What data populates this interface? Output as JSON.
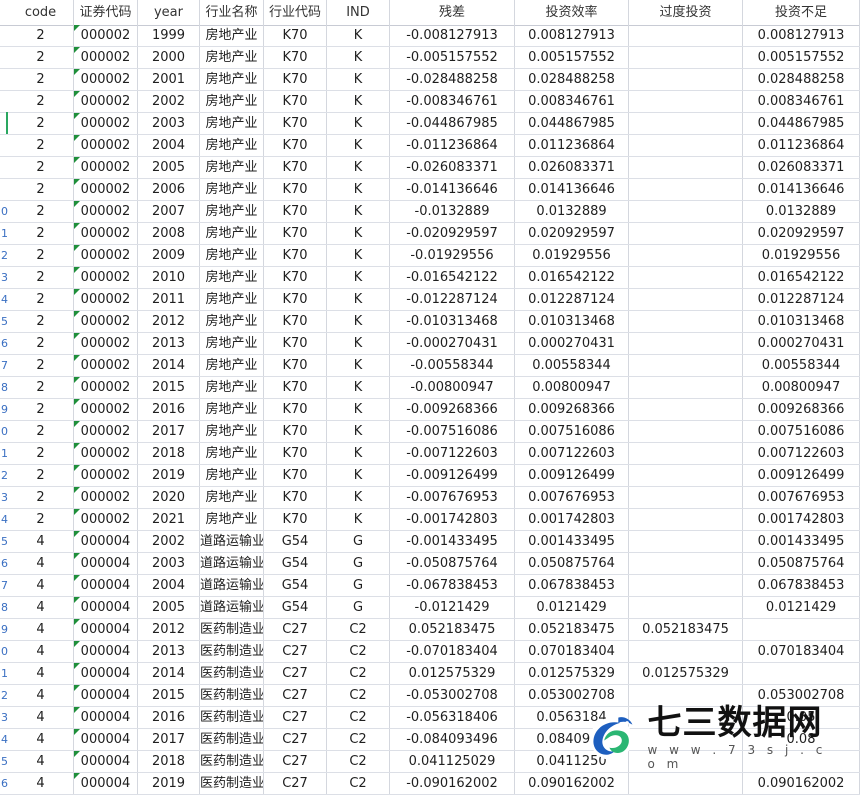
{
  "columns": [
    "code",
    "证券代码",
    "year",
    "行业名称",
    "行业代码",
    "IND",
    "残差",
    "投资效率",
    "过度投资",
    "投资不足"
  ],
  "left_row_numbers": [
    "",
    "",
    "",
    "",
    "",
    "",
    "",
    "",
    "0",
    "1",
    "2",
    "3",
    "4",
    "5",
    "6",
    "7",
    "8",
    "9",
    "0",
    "1",
    "2",
    "3",
    "4",
    "5",
    "6",
    "7",
    "8",
    "9",
    "0",
    "1",
    "2",
    "3",
    "4",
    "5",
    "6"
  ],
  "rows": [
    [
      "2",
      "000002",
      "1999",
      "房地产业",
      "K70",
      "K",
      "-0.008127913",
      "0.008127913",
      "",
      "0.008127913"
    ],
    [
      "2",
      "000002",
      "2000",
      "房地产业",
      "K70",
      "K",
      "-0.005157552",
      "0.005157552",
      "",
      "0.005157552"
    ],
    [
      "2",
      "000002",
      "2001",
      "房地产业",
      "K70",
      "K",
      "-0.028488258",
      "0.028488258",
      "",
      "0.028488258"
    ],
    [
      "2",
      "000002",
      "2002",
      "房地产业",
      "K70",
      "K",
      "-0.008346761",
      "0.008346761",
      "",
      "0.008346761"
    ],
    [
      "2",
      "000002",
      "2003",
      "房地产业",
      "K70",
      "K",
      "-0.044867985",
      "0.044867985",
      "",
      "0.044867985"
    ],
    [
      "2",
      "000002",
      "2004",
      "房地产业",
      "K70",
      "K",
      "-0.011236864",
      "0.011236864",
      "",
      "0.011236864"
    ],
    [
      "2",
      "000002",
      "2005",
      "房地产业",
      "K70",
      "K",
      "-0.026083371",
      "0.026083371",
      "",
      "0.026083371"
    ],
    [
      "2",
      "000002",
      "2006",
      "房地产业",
      "K70",
      "K",
      "-0.014136646",
      "0.014136646",
      "",
      "0.014136646"
    ],
    [
      "2",
      "000002",
      "2007",
      "房地产业",
      "K70",
      "K",
      "-0.0132889",
      "0.0132889",
      "",
      "0.0132889"
    ],
    [
      "2",
      "000002",
      "2008",
      "房地产业",
      "K70",
      "K",
      "-0.020929597",
      "0.020929597",
      "",
      "0.020929597"
    ],
    [
      "2",
      "000002",
      "2009",
      "房地产业",
      "K70",
      "K",
      "-0.01929556",
      "0.01929556",
      "",
      "0.01929556"
    ],
    [
      "2",
      "000002",
      "2010",
      "房地产业",
      "K70",
      "K",
      "-0.016542122",
      "0.016542122",
      "",
      "0.016542122"
    ],
    [
      "2",
      "000002",
      "2011",
      "房地产业",
      "K70",
      "K",
      "-0.012287124",
      "0.012287124",
      "",
      "0.012287124"
    ],
    [
      "2",
      "000002",
      "2012",
      "房地产业",
      "K70",
      "K",
      "-0.010313468",
      "0.010313468",
      "",
      "0.010313468"
    ],
    [
      "2",
      "000002",
      "2013",
      "房地产业",
      "K70",
      "K",
      "-0.000270431",
      "0.000270431",
      "",
      "0.000270431"
    ],
    [
      "2",
      "000002",
      "2014",
      "房地产业",
      "K70",
      "K",
      "-0.00558344",
      "0.00558344",
      "",
      "0.00558344"
    ],
    [
      "2",
      "000002",
      "2015",
      "房地产业",
      "K70",
      "K",
      "-0.00800947",
      "0.00800947",
      "",
      "0.00800947"
    ],
    [
      "2",
      "000002",
      "2016",
      "房地产业",
      "K70",
      "K",
      "-0.009268366",
      "0.009268366",
      "",
      "0.009268366"
    ],
    [
      "2",
      "000002",
      "2017",
      "房地产业",
      "K70",
      "K",
      "-0.007516086",
      "0.007516086",
      "",
      "0.007516086"
    ],
    [
      "2",
      "000002",
      "2018",
      "房地产业",
      "K70",
      "K",
      "-0.007122603",
      "0.007122603",
      "",
      "0.007122603"
    ],
    [
      "2",
      "000002",
      "2019",
      "房地产业",
      "K70",
      "K",
      "-0.009126499",
      "0.009126499",
      "",
      "0.009126499"
    ],
    [
      "2",
      "000002",
      "2020",
      "房地产业",
      "K70",
      "K",
      "-0.007676953",
      "0.007676953",
      "",
      "0.007676953"
    ],
    [
      "2",
      "000002",
      "2021",
      "房地产业",
      "K70",
      "K",
      "-0.001742803",
      "0.001742803",
      "",
      "0.001742803"
    ],
    [
      "4",
      "000004",
      "2002",
      "道路运输业",
      "G54",
      "G",
      "-0.001433495",
      "0.001433495",
      "",
      "0.001433495"
    ],
    [
      "4",
      "000004",
      "2003",
      "道路运输业",
      "G54",
      "G",
      "-0.050875764",
      "0.050875764",
      "",
      "0.050875764"
    ],
    [
      "4",
      "000004",
      "2004",
      "道路运输业",
      "G54",
      "G",
      "-0.067838453",
      "0.067838453",
      "",
      "0.067838453"
    ],
    [
      "4",
      "000004",
      "2005",
      "道路运输业",
      "G54",
      "G",
      "-0.0121429",
      "0.0121429",
      "",
      "0.0121429"
    ],
    [
      "4",
      "000004",
      "2012",
      "医药制造业",
      "C27",
      "C2",
      "0.052183475",
      "0.052183475",
      "0.052183475",
      ""
    ],
    [
      "4",
      "000004",
      "2013",
      "医药制造业",
      "C27",
      "C2",
      "-0.070183404",
      "0.070183404",
      "",
      "0.070183404"
    ],
    [
      "4",
      "000004",
      "2014",
      "医药制造业",
      "C27",
      "C2",
      "0.012575329",
      "0.012575329",
      "0.012575329",
      ""
    ],
    [
      "4",
      "000004",
      "2015",
      "医药制造业",
      "C27",
      "C2",
      "-0.053002708",
      "0.053002708",
      "",
      "0.053002708"
    ],
    [
      "4",
      "000004",
      "2016",
      "医药制造业",
      "C27",
      "C2",
      "-0.056318406",
      "0.0563184",
      "",
      "0.05"
    ],
    [
      "4",
      "000004",
      "2017",
      "医药制造业",
      "C27",
      "C2",
      "-0.084093496",
      "0.0840934",
      "",
      "0.08"
    ],
    [
      "4",
      "000004",
      "2018",
      "医药制造业",
      "C27",
      "C2",
      "0.041125029",
      "0.0411250",
      "",
      ""
    ],
    [
      "4",
      "000004",
      "2019",
      "医药制造业",
      "C27",
      "C2",
      "-0.090162002",
      "0.090162002",
      "",
      "0.090162002"
    ]
  ],
  "watermark": {
    "title": "七三数据网",
    "subtitle": "w w w . 7 3 s j . c o m"
  },
  "colors": {
    "grid": "#d4d7de",
    "text_marker": "#1f8f3a",
    "selection": "#2aa760"
  }
}
